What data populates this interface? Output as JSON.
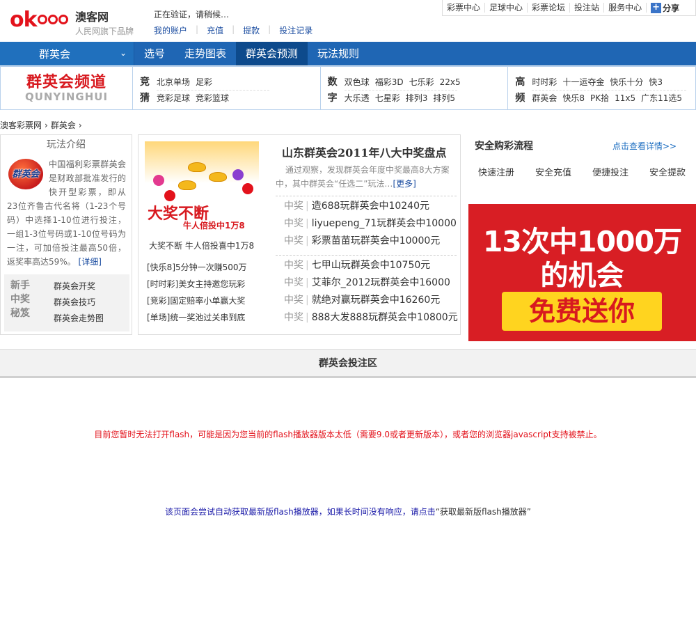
{
  "header": {
    "logo_text": "okooo",
    "brand_name": "澳客网",
    "brand_sub": "人民网旗下品牌",
    "verify_text": "正在验证，请稍候…",
    "account_links": [
      "我的账户",
      "充值",
      "提款",
      "投注记录"
    ],
    "top_links": [
      "彩票中心",
      "足球中心",
      "彩票论坛",
      "投注站",
      "服务中心"
    ],
    "share_label": "分享"
  },
  "nav": {
    "select_label": "群英会",
    "items": [
      "选号",
      "走势图表",
      "群英会预测",
      "玩法规则"
    ],
    "active_index": 2
  },
  "channel": {
    "title": "群英会频道",
    "subtitle": "QUNYINGHUI",
    "groups": [
      {
        "tag": "竞猜",
        "rows": [
          [
            "北京单场",
            "足彩"
          ],
          [
            "竞彩足球",
            "竞彩篮球"
          ]
        ]
      },
      {
        "tag": "数字",
        "rows": [
          [
            "双色球",
            "福彩3D",
            "七乐彩",
            "22x5"
          ],
          [
            "大乐透",
            "七星彩",
            "排列3",
            "排列5"
          ]
        ]
      },
      {
        "tag": "高频",
        "rows": [
          [
            "时时彩",
            "十一运夺金",
            "快乐十分",
            "快3"
          ],
          [
            "群英会",
            "快乐8",
            "PK拾",
            "11x5",
            "广东11选5"
          ]
        ]
      }
    ]
  },
  "breadcrumb": [
    "澳客彩票网",
    "群英会"
  ],
  "intro": {
    "title": "玩法介绍",
    "logo_text": "群英会",
    "text": "中国福利彩票群英会是财政部批准发行的快开型彩票，即从23位齐鲁古代名将（1-23个号码）中选择1-10位进行投注，一组1-3位号码或1-10位号码为一注，可加倍投注最高50倍，返奖率高达59%。",
    "more": "[详细]",
    "tips_tag": "新手中奖秘笈",
    "tips": [
      "群英会开奖",
      "群英会技巧",
      "群英会走势图"
    ]
  },
  "news": {
    "banner_big": "大奖不断",
    "banner_small": "牛人倍投中1万8",
    "banner_caption": "大奖不断 牛人倍投喜中1万8",
    "list": [
      "[快乐8]5分钟一次赚500万",
      "[时时彩]美女主持邀您玩彩",
      "[竞彩]固定赔率小单赢大奖",
      "[单场]统一奖池过关串到底"
    ],
    "headline": "山东群英会2011年八大中奖盘点",
    "summary": "通过观察，发现群英会年度中奖最高8大方案中，其中群英会“任选二”玩法…",
    "summary_more": "[更多]",
    "win_label": "中奖",
    "wins_a": [
      "造688玩群英会中10240元",
      "liyuepeng_71玩群英会中10000",
      "彩票苗苗玩群英会中10000元"
    ],
    "wins_b": [
      "七甲山玩群英会中10750元",
      "艾菲尔_2012玩群英会中16000",
      "就绝对赢玩群英会中16260元",
      "888大发888玩群英会中10800元"
    ]
  },
  "safe": {
    "title": "安全购彩流程",
    "detail_link": "点击查看详情>>",
    "steps": [
      "快速注册",
      "安全充值",
      "便捷投注",
      "安全提款"
    ]
  },
  "ad": {
    "line1": "13次中1000万",
    "line2": "的机会",
    "button": "免费送你"
  },
  "zone": {
    "title": "群英会投注区",
    "flash_msg": "目前您暂时无法打开flash，可能是因为您当前的flash播放器版本太低（需要9.0或者更新版本），或者您的浏览器javascript支持被禁止。",
    "flash_help": "该页面会尝试自动获取最新版flash播放器，如果长时间没有响应，请点击",
    "flash_download": "“获取最新版flash播放器”"
  },
  "colors": {
    "brand_red": "#e3121b",
    "nav_blue": "#1f66b4",
    "nav_active": "#0d4a8c",
    "link_blue": "#1a4ca0",
    "ad_red": "#d81e24",
    "ad_yellow": "#ffd41f"
  },
  "icons": {
    "nav_select": "chevron-down-icon",
    "share": "share-plus-icon",
    "breadcrumb": "chevron-right-icon"
  }
}
